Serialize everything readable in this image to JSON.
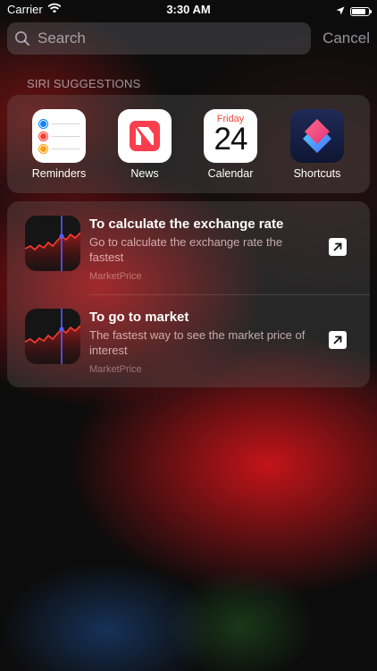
{
  "status_bar": {
    "carrier": "Carrier",
    "time": "3:30 AM",
    "battery_level": 0.9
  },
  "search": {
    "placeholder": "Search",
    "value": "",
    "cancel_label": "Cancel"
  },
  "siri": {
    "section_title": "SIRI SUGGESTIONS",
    "apps": [
      {
        "label": "Reminders",
        "icon": "reminders-icon"
      },
      {
        "label": "News",
        "icon": "news-icon"
      },
      {
        "label": "Calendar",
        "icon": "calendar-icon",
        "day": "Friday",
        "date": "24"
      },
      {
        "label": "Shortcuts",
        "icon": "shortcuts-icon"
      }
    ],
    "suggestions": [
      {
        "title": "To calculate the exchange rate",
        "subtitle": "Go to calculate the exchange rate the fastest",
        "app": "MarketPrice",
        "icon": "stock-chart-icon"
      },
      {
        "title": "To go to market",
        "subtitle": "The fastest way to see the market price of interest",
        "app": "MarketPrice",
        "icon": "stock-chart-icon"
      }
    ]
  },
  "colors": {
    "reminder_blue": "#0a84ff",
    "reminder_red": "#ff3b30",
    "reminder_orange": "#ff9f0a",
    "news_red": "#fa3e4d",
    "calendar_red": "#f2483a",
    "chart_red": "#ff3b30",
    "chart_blue": "#5b5bff"
  }
}
